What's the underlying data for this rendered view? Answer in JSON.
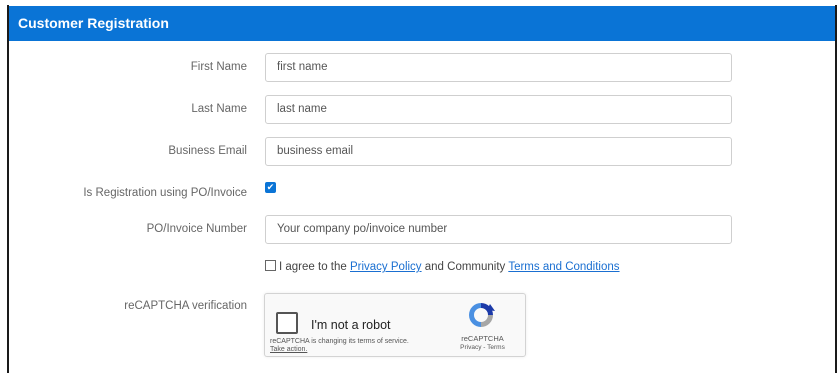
{
  "header": {
    "title": "Customer Registration"
  },
  "form": {
    "first_name": {
      "label": "First Name",
      "placeholder": "first name"
    },
    "last_name": {
      "label": "Last Name",
      "placeholder": "last name"
    },
    "business_email": {
      "label": "Business Email",
      "placeholder": "business email"
    },
    "po_invoice_toggle": {
      "label": "Is Registration using PO/Invoice",
      "checked": true
    },
    "po_invoice_number": {
      "label": "PO/Invoice Number",
      "placeholder": "Your company po/invoice number"
    },
    "agree": {
      "prefix": "I agree to the",
      "privacy_link": "Privacy Policy",
      "middle": "and Community",
      "terms_link": "Terms and Conditions"
    },
    "recaptcha": {
      "label": "reCAPTCHA verification",
      "not_robot": "I'm not a robot",
      "notice": "reCAPTCHA is changing its terms of service.",
      "take_action": "Take action.",
      "brand": "reCAPTCHA",
      "legal": "Privacy - Terms"
    }
  },
  "colors": {
    "accent": "#0a74d6",
    "link": "#1a6fd1"
  },
  "icons": {
    "captcha_logo": "recaptcha-logo-icon",
    "checkmark": "checkmark-icon"
  }
}
